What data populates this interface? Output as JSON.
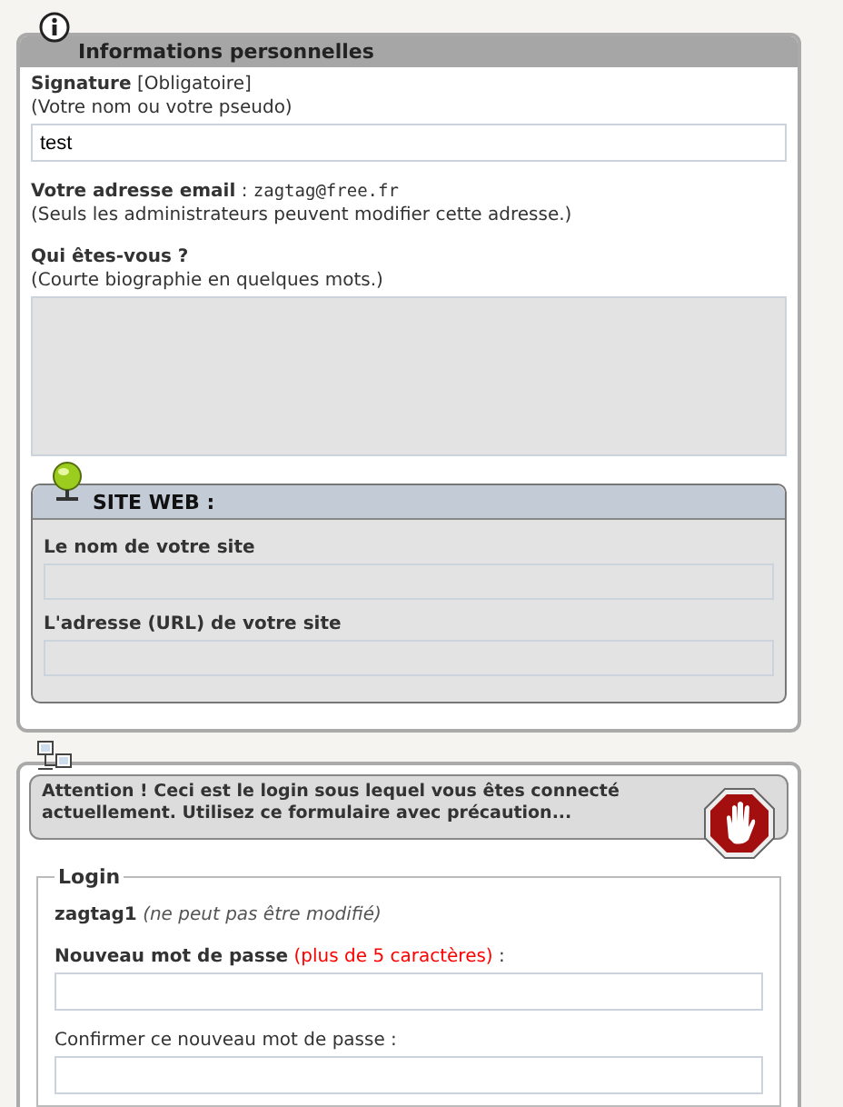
{
  "personal": {
    "title": "Informations personnelles",
    "signature": {
      "label": "**Signature** [Obligatoire]",
      "hint": "(Votre nom ou votre pseudo)",
      "value": "test"
    },
    "email": {
      "label": "**Votre adresse email** :",
      "value": "zagtag@free.fr",
      "hint": "(Seuls les administrateurs peuvent modifier cette adresse.)"
    },
    "bio": {
      "label": "Qui êtes-vous ?",
      "hint": "(Courte biographie en quelques mots.)"
    },
    "website": {
      "title": "SITE WEB :",
      "fields": [
        {
          "label": "Le nom de votre site"
        },
        {
          "label": "L'adresse (URL) de votre site"
        }
      ]
    }
  },
  "account": {
    "warning": "Attention ! Ceci est le login sous lequel vous êtes connecté actuellement. Utilisez ce formulaire avec précaution...",
    "legend": "Login",
    "username": "zagtag1",
    "username_note": "(ne peut pas être modifié)",
    "new_password": {
      "label": "Nouveau mot de passe",
      "requirement": "(plus de 5 caractères)",
      "suffix": ":"
    },
    "confirm_password": {
      "label": "Confirmer ce nouveau mot de passe :"
    }
  }
}
